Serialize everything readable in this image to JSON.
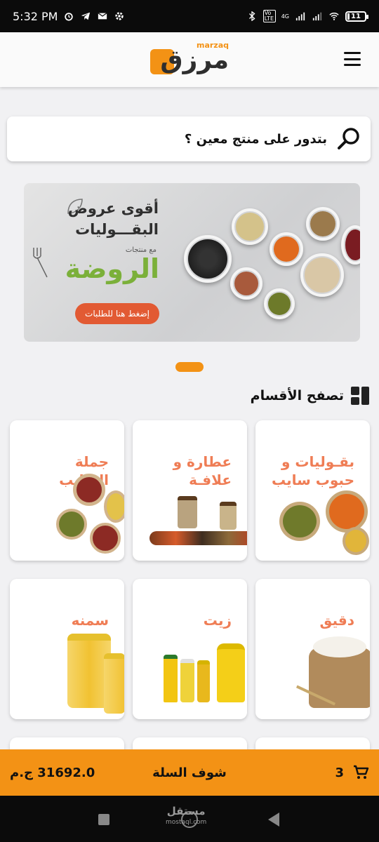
{
  "status_bar": {
    "time": "5:32 PM",
    "battery": "11",
    "network": "4G",
    "volte": "Vo LTE"
  },
  "header": {
    "logo_arabic": "مرزق",
    "logo_latin": "marzaq"
  },
  "search": {
    "placeholder": "بتدور على منتج معين ؟"
  },
  "banner": {
    "line1": "أقوى عروض",
    "line2": "البقـــوليات",
    "small": "مع منتجات",
    "brand": "الروضة",
    "cta": "إضغط هنا للطلبات"
  },
  "categories_section": {
    "title": "تصفح الأقسام"
  },
  "categories": [
    {
      "label": "بقـوليات و\nحبوب سايب"
    },
    {
      "label": "عطارة و\nعلافـة"
    },
    {
      "label": "جملة\nالسايب"
    },
    {
      "label": "دقيق"
    },
    {
      "label": "زيت"
    },
    {
      "label": "سمنه"
    }
  ],
  "cart": {
    "count": "3",
    "view_label": "شوف السلة",
    "total": "31692.0 ج.م"
  },
  "watermark": {
    "ar": "مستقل",
    "en": "mostaql.com"
  },
  "colors": {
    "accent": "#f39215",
    "category_text": "#ef7d55",
    "banner_green": "#7bb03a",
    "banner_cta": "#e25a33"
  }
}
